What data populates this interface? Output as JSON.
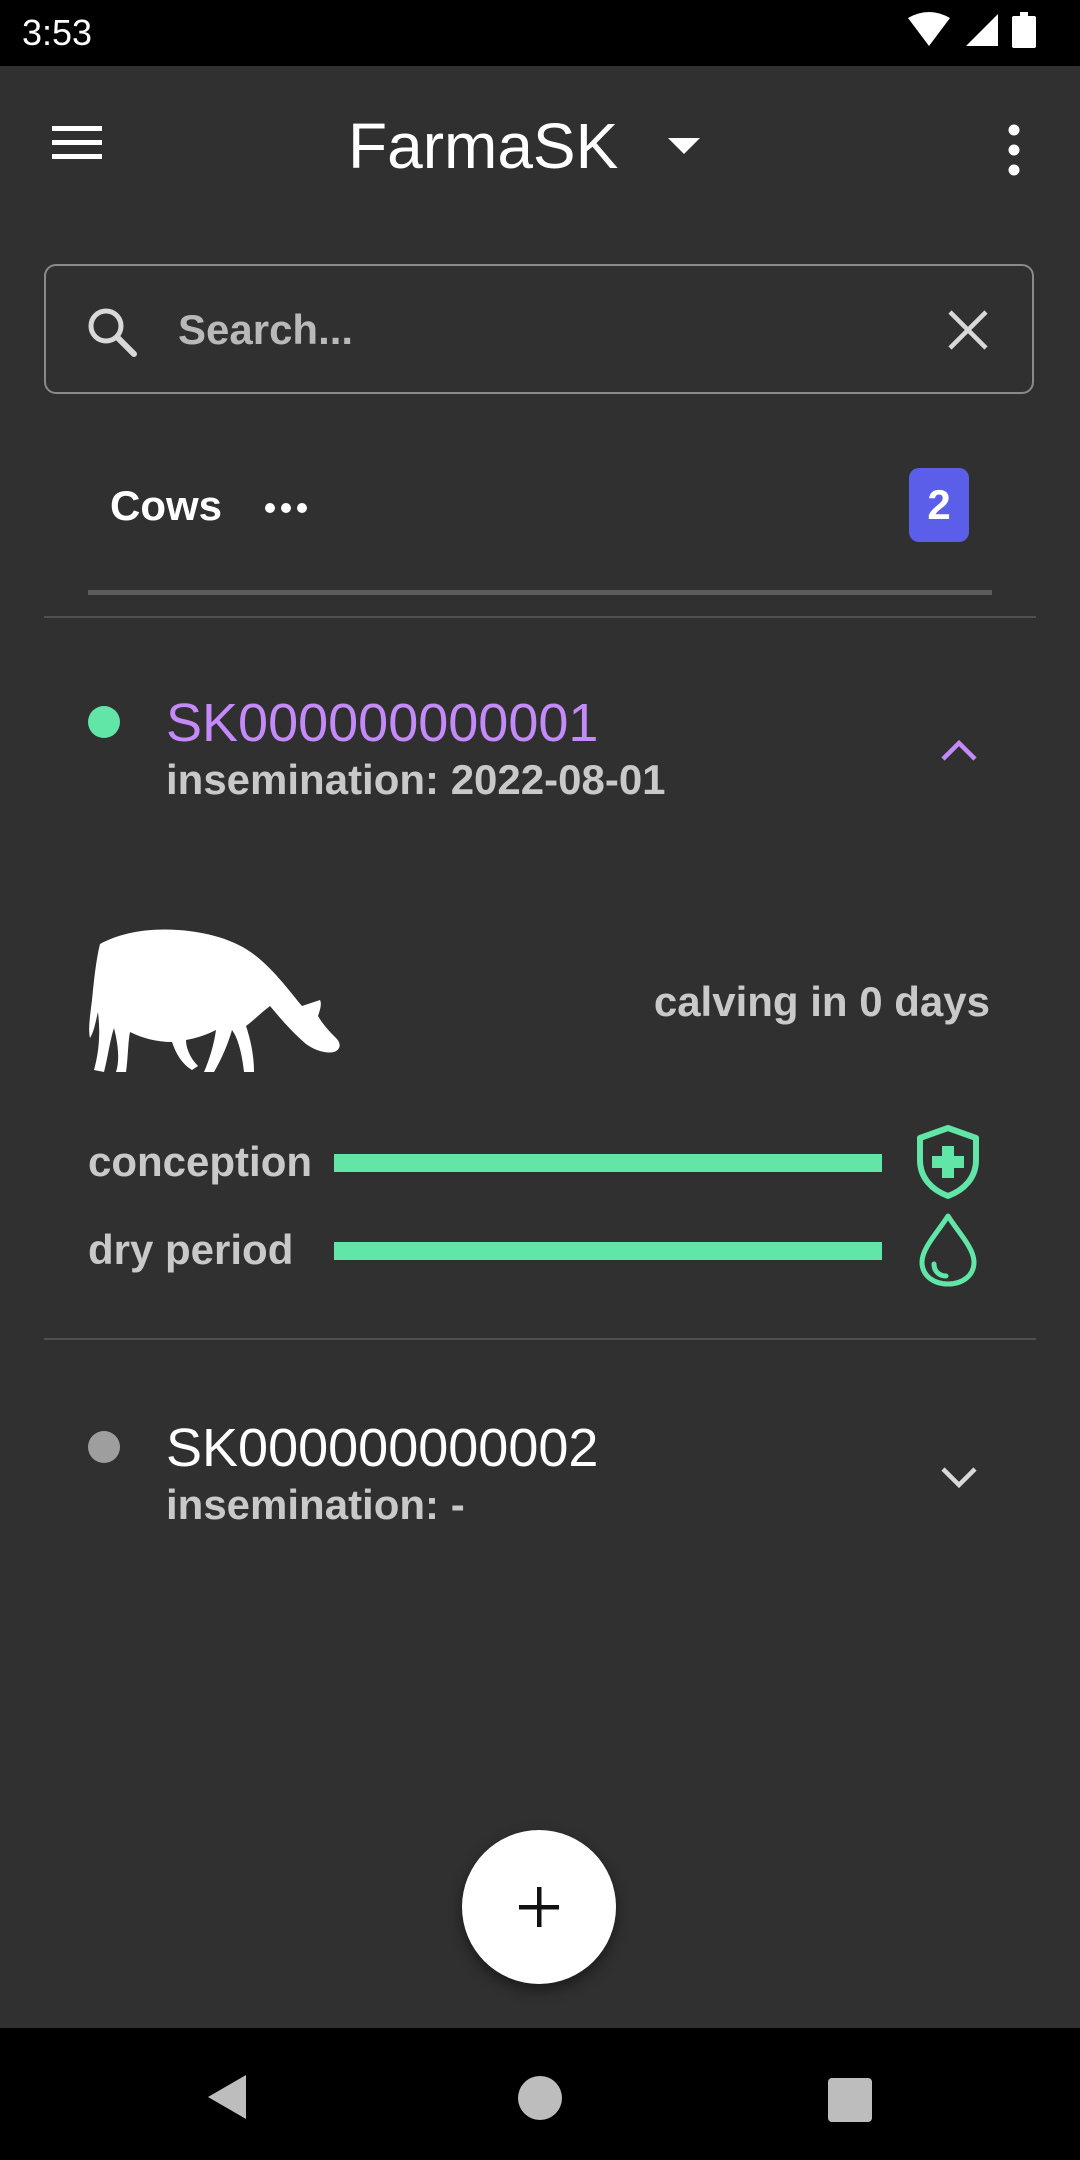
{
  "status_bar": {
    "time": "3:53"
  },
  "app_bar": {
    "title": "FarmaSK"
  },
  "search": {
    "placeholder": "Search...",
    "value": ""
  },
  "section": {
    "title": "Cows",
    "count": "2"
  },
  "cows": [
    {
      "id": "SK000000000001",
      "subtitle": "insemination: 2022-08-01",
      "status_color": "#62e6a8",
      "expanded": true,
      "calving_text": "calving in 0 days",
      "progress": [
        {
          "label": "conception",
          "value": 1.0,
          "icon": "shield-plus-icon"
        },
        {
          "label": "dry period",
          "value": 1.0,
          "icon": "water-drop-icon"
        }
      ]
    },
    {
      "id": "SK000000000002",
      "subtitle": "insemination: -",
      "status_color": "#9e9e9e",
      "expanded": false
    }
  ],
  "colors": {
    "background": "#303030",
    "accent_green": "#62e6a8",
    "accent_purple": "#c58af9",
    "badge_blue": "#5a5ee8"
  },
  "icons": {
    "menu": "menu-icon",
    "title_dropdown": "arrow-drop-down-icon",
    "overflow": "more-vert-icon",
    "search": "search-icon",
    "clear": "close-icon",
    "section_more": "more-horiz-icon",
    "expand_less": "chevron-up-icon",
    "expand_more": "chevron-down-icon",
    "fab": "add-icon"
  }
}
